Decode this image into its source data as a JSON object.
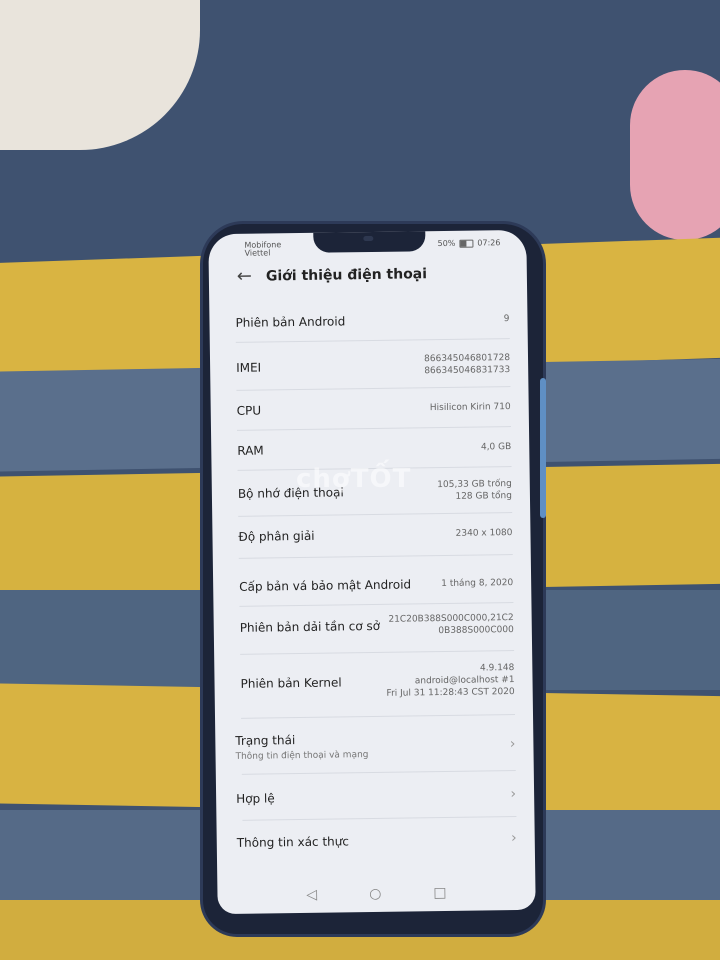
{
  "status_bar": {
    "carrier_line1": "Mobifone",
    "carrier_line2": "Viettel",
    "battery": "50%",
    "time": "07:26"
  },
  "header": {
    "back_icon": "arrow-left-icon",
    "title": "Giới thiệu điện thoại"
  },
  "info_rows": [
    {
      "label": "Phiên bản Android",
      "value": "9"
    },
    {
      "label": "IMEI",
      "value": "866345046801728\n866345046831733"
    },
    {
      "label": "CPU",
      "value": "Hisilicon Kirin 710"
    },
    {
      "label": "RAM",
      "value": "4,0 GB"
    },
    {
      "label": "Bộ nhớ điện thoại",
      "value": "105,33  GB trống\n128  GB tổng"
    },
    {
      "label": "Độ phân giải",
      "value": "2340 x 1080"
    },
    {
      "label": "Cấp bản vá bảo mật Android",
      "value": "1 tháng 8, 2020"
    },
    {
      "label": "Phiên bản dải tần cơ sở",
      "value": "21C20B388S000C000,21C2\n0B388S000C000"
    },
    {
      "label": "Phiên bản Kernel",
      "value": "4.9.148\nandroid@localhost #1\nFri Jul 31 11:28:43 CST 2020"
    }
  ],
  "nav_items": [
    {
      "label": "Trạng thái",
      "sub": "Thông tin điện thoại và mạng"
    },
    {
      "label": "Hợp lệ",
      "sub": ""
    },
    {
      "label": "Thông tin xác thực",
      "sub": ""
    }
  ],
  "bottom_nav": {
    "back": "◁",
    "home": "○",
    "recents": "□"
  },
  "watermark": "chợTỐT"
}
